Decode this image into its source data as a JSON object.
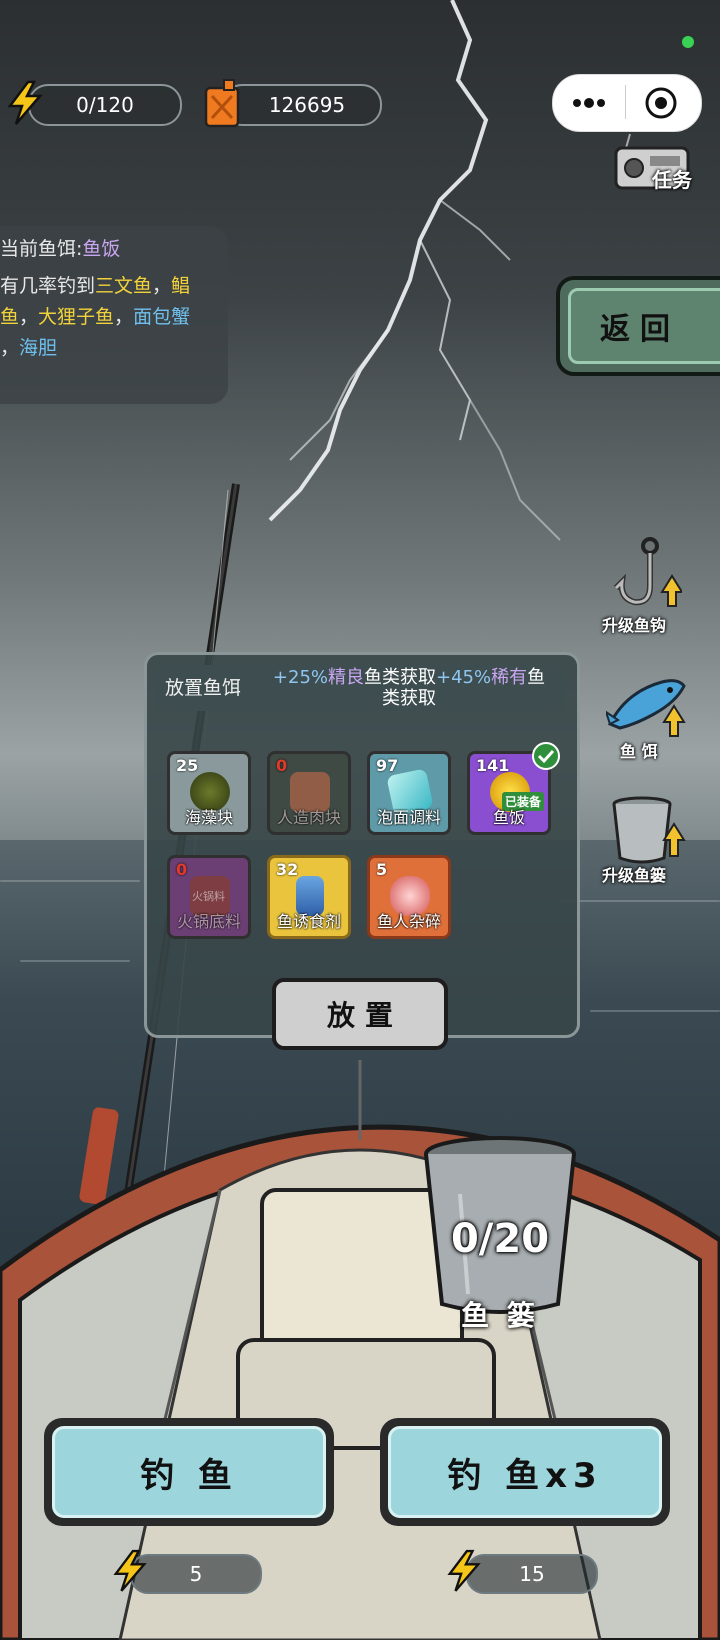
{
  "hud": {
    "energy": "0/120",
    "fuel": "126695",
    "task_label": "任务"
  },
  "bait_info": {
    "current_label": "当前鱼饵:",
    "current_bait": "鱼饭",
    "line2_prefix": "有几率钓到",
    "line2_fish1": "三文鱼",
    "line2_sep1": "，",
    "line2_fish2": "鲳",
    "line3_fish2_end": "鱼",
    "line3_sep1": "，",
    "line3_fish3": "大狸子鱼",
    "line3_sep2": "，",
    "line3_fish4": "面包蟹",
    "line4_sep": "，",
    "line4_fish5": "海胆"
  },
  "return_label": "返回",
  "side_menu": {
    "upgrade_hook": "升级鱼钩",
    "bait": "鱼 饵",
    "upgrade_basket": "升级鱼篓"
  },
  "dialog": {
    "title": "放置鱼饵",
    "bonus1_value": "+25%",
    "bonus1_rarity": "精良",
    "bonus1_text": "鱼类获取",
    "bonus2_value": "+45%",
    "bonus2_rarity": "稀有",
    "bonus2_text1": "鱼",
    "bonus2_text2": "类获取",
    "equipped_tag": "已装备",
    "items": [
      {
        "count": "25",
        "name": "海藻块"
      },
      {
        "count": "0",
        "name": "人造肉块"
      },
      {
        "count": "97",
        "name": "泡面调料"
      },
      {
        "count": "141",
        "name": "鱼饭"
      },
      {
        "count": "0",
        "name": "火锅底料",
        "art_text": "火锅料"
      },
      {
        "count": "32",
        "name": "鱼诱食剂"
      },
      {
        "count": "5",
        "name": "鱼人杂碎"
      }
    ],
    "place_button": "放置"
  },
  "basket": {
    "count": "0/20",
    "label": "鱼 篓"
  },
  "actions": {
    "fish_label": "钓 鱼",
    "fish_cost": "5",
    "fish3_label": "钓 鱼x3",
    "fish3_cost": "15"
  },
  "colors": {
    "accent_green": "#4f6b5d",
    "button_cyan": "#9cd6dc",
    "bait_purple": "#c9a6f0",
    "fish_yellow": "#f2d23a",
    "fish_blue": "#6fc0ee"
  }
}
